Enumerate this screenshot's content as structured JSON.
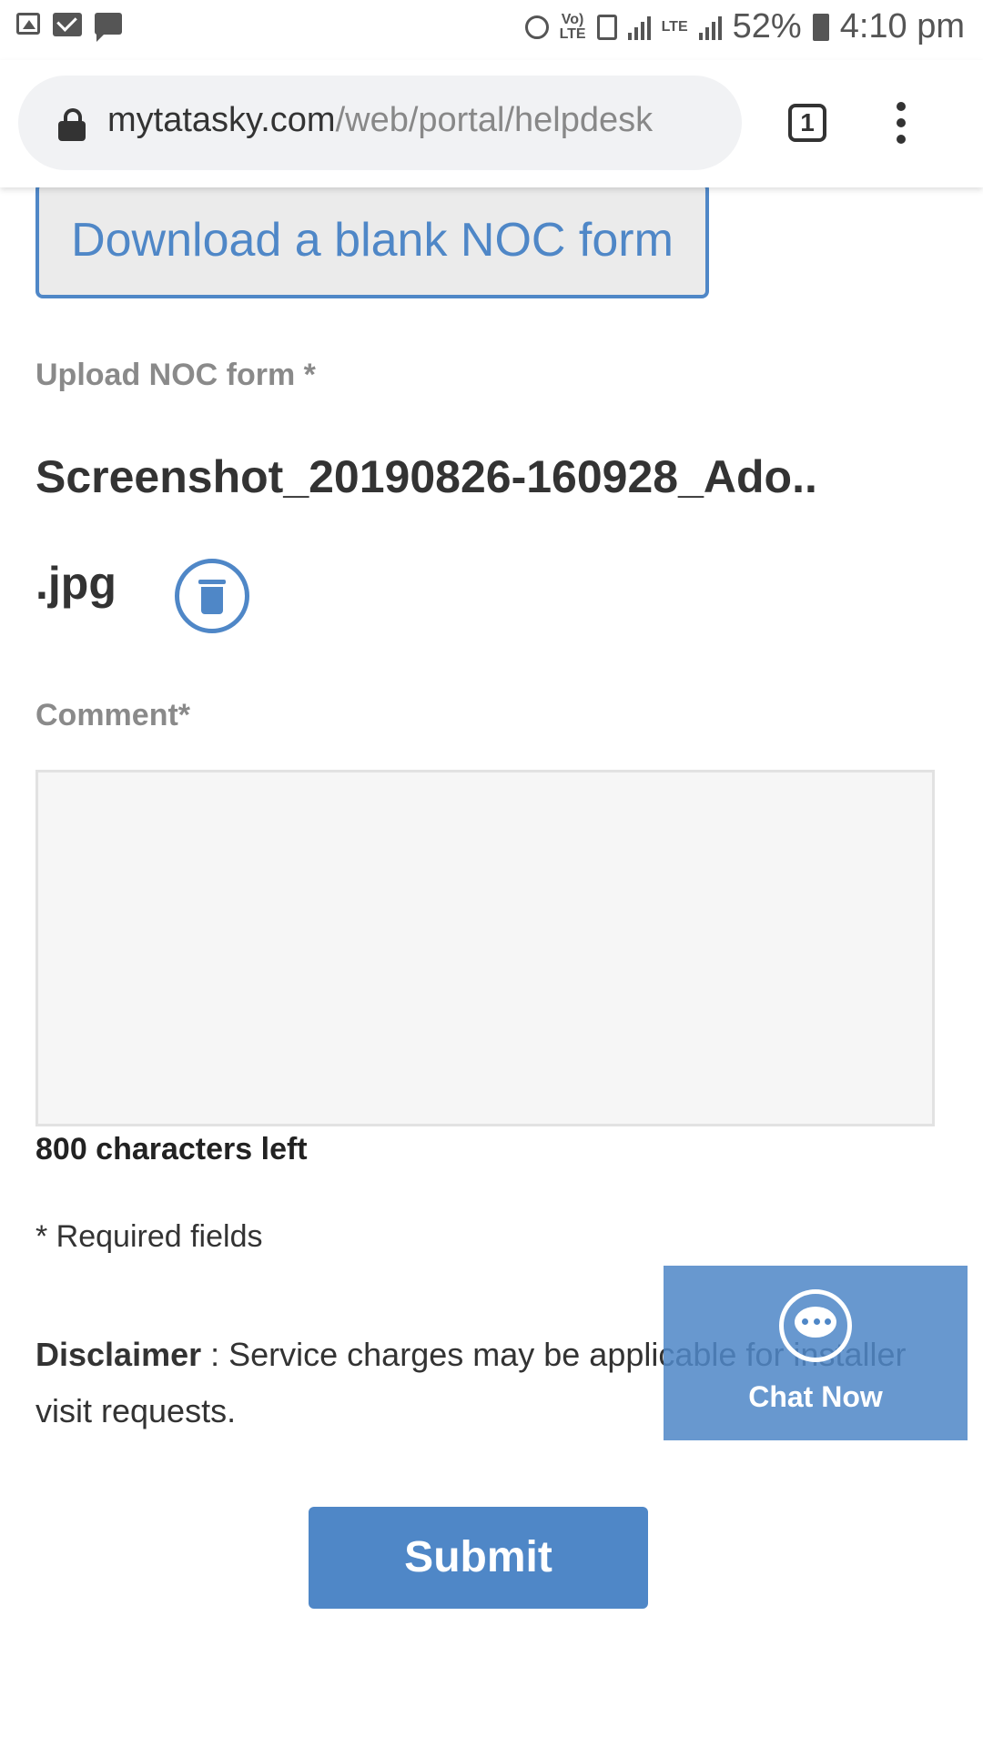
{
  "status_bar": {
    "left_icons": [
      "image-icon",
      "mail-icon",
      "message-icon"
    ],
    "network_top": "Vo)",
    "network_bottom": "LTE",
    "lte_label": "LTE",
    "battery_percent": "52%",
    "time": "4:10 pm"
  },
  "browser": {
    "url_host": "mytatasky.com",
    "url_path": "/web/portal/helpdesk",
    "tab_count": "1"
  },
  "form": {
    "download_button": "Download a blank NOC form",
    "upload_label": "Upload NOC form *",
    "file_name": "Screenshot_20190826-160928_Ado..",
    "file_ext": ".jpg",
    "comment_label": "Comment*",
    "comment_value": "",
    "chars_left": "800 characters left",
    "required_note": "* Required fields",
    "disclaimer_label": "Disclaimer",
    "disclaimer_text": " : Service charges may be applicable for installer visit requests.",
    "submit_label": "Submit"
  },
  "chat": {
    "label": "Chat Now"
  },
  "colors": {
    "accent": "#4f87c7",
    "chat_background": "#4f87c7",
    "comment_background": "#f6f6f6"
  }
}
